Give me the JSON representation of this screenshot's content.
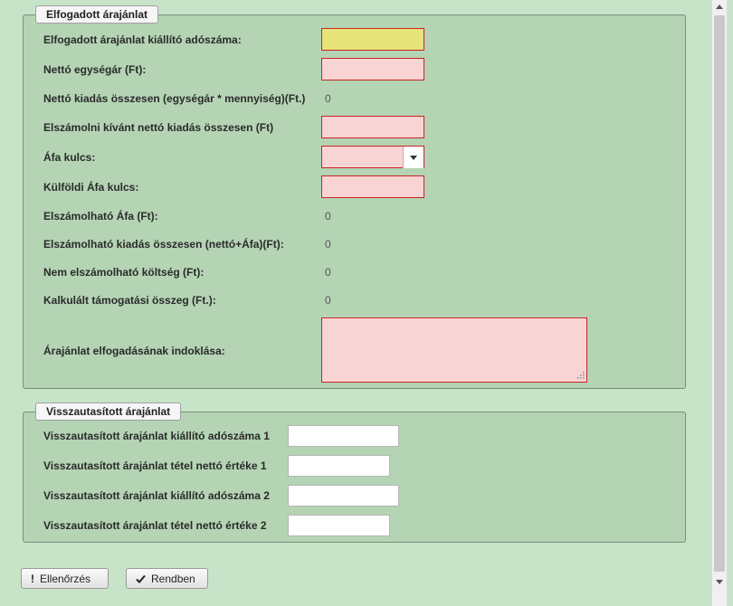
{
  "accepted_section": {
    "legend": "Elfogadott árajánlat",
    "tax_id_label": "Elfogadott árajánlat kiállító adószáma:",
    "tax_id_value": "",
    "net_unit_price_label": "Nettó egységár (Ft):",
    "net_unit_price_value": "",
    "net_total_label": "Nettó kiadás összesen (egységár * mennyiség)(Ft.)",
    "net_total_value": "0",
    "claimed_net_label": "Elszámolni kívánt nettó kiadás összesen (Ft)",
    "claimed_net_value": "",
    "vat_rate_label": "Áfa kulcs:",
    "vat_rate_value": "",
    "foreign_vat_label": "Külföldi Áfa kulcs:",
    "foreign_vat_value": "",
    "eligible_vat_label": "Elszámolható Áfa (Ft):",
    "eligible_vat_value": "0",
    "eligible_total_label": "Elszámolható kiadás összesen (nettó+Áfa)(Ft):",
    "eligible_total_value": "0",
    "non_eligible_label": "Nem elszámolható költség (Ft):",
    "non_eligible_value": "0",
    "calculated_support_label": "Kalkulált támogatási összeg (Ft.):",
    "calculated_support_value": "0",
    "justification_label": "Árajánlat elfogadásának indoklása:",
    "justification_value": ""
  },
  "rejected_section": {
    "legend": "Visszautasított árajánlat",
    "tax_id_1_label": "Visszautasított árajánlat kiállító adószáma 1",
    "tax_id_1_value": "",
    "net_value_1_label": "Visszautasított árajánlat tétel nettó értéke 1",
    "net_value_1_value": "",
    "tax_id_2_label": "Visszautasított árajánlat kiállító adószáma 2",
    "tax_id_2_value": "",
    "net_value_2_label": "Visszautasított árajánlat tétel nettó értéke 2",
    "net_value_2_value": ""
  },
  "buttons": {
    "check_label": "Ellenőrzés",
    "check_icon": "exclamation-icon",
    "ok_label": "Rendben",
    "ok_icon": "checkmark-icon"
  },
  "colors": {
    "page_background": "#c8e4c8",
    "fieldset_background": "#b4d4b4",
    "required_field": "#f8d4d4",
    "highlight_field": "#e6e47a",
    "error_border": "#cc2222"
  }
}
